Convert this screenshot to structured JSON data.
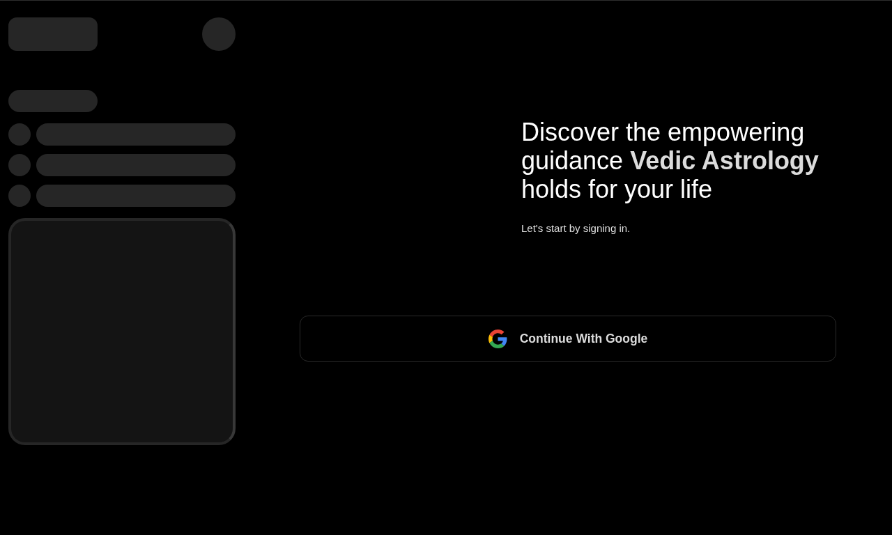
{
  "hero": {
    "heading": "Discover the empowering guidance **Vedic Astrology** holds for your life",
    "subtitle": "Let's start by signing in."
  },
  "sign_in_button": {
    "label": "Continue With Google"
  }
}
